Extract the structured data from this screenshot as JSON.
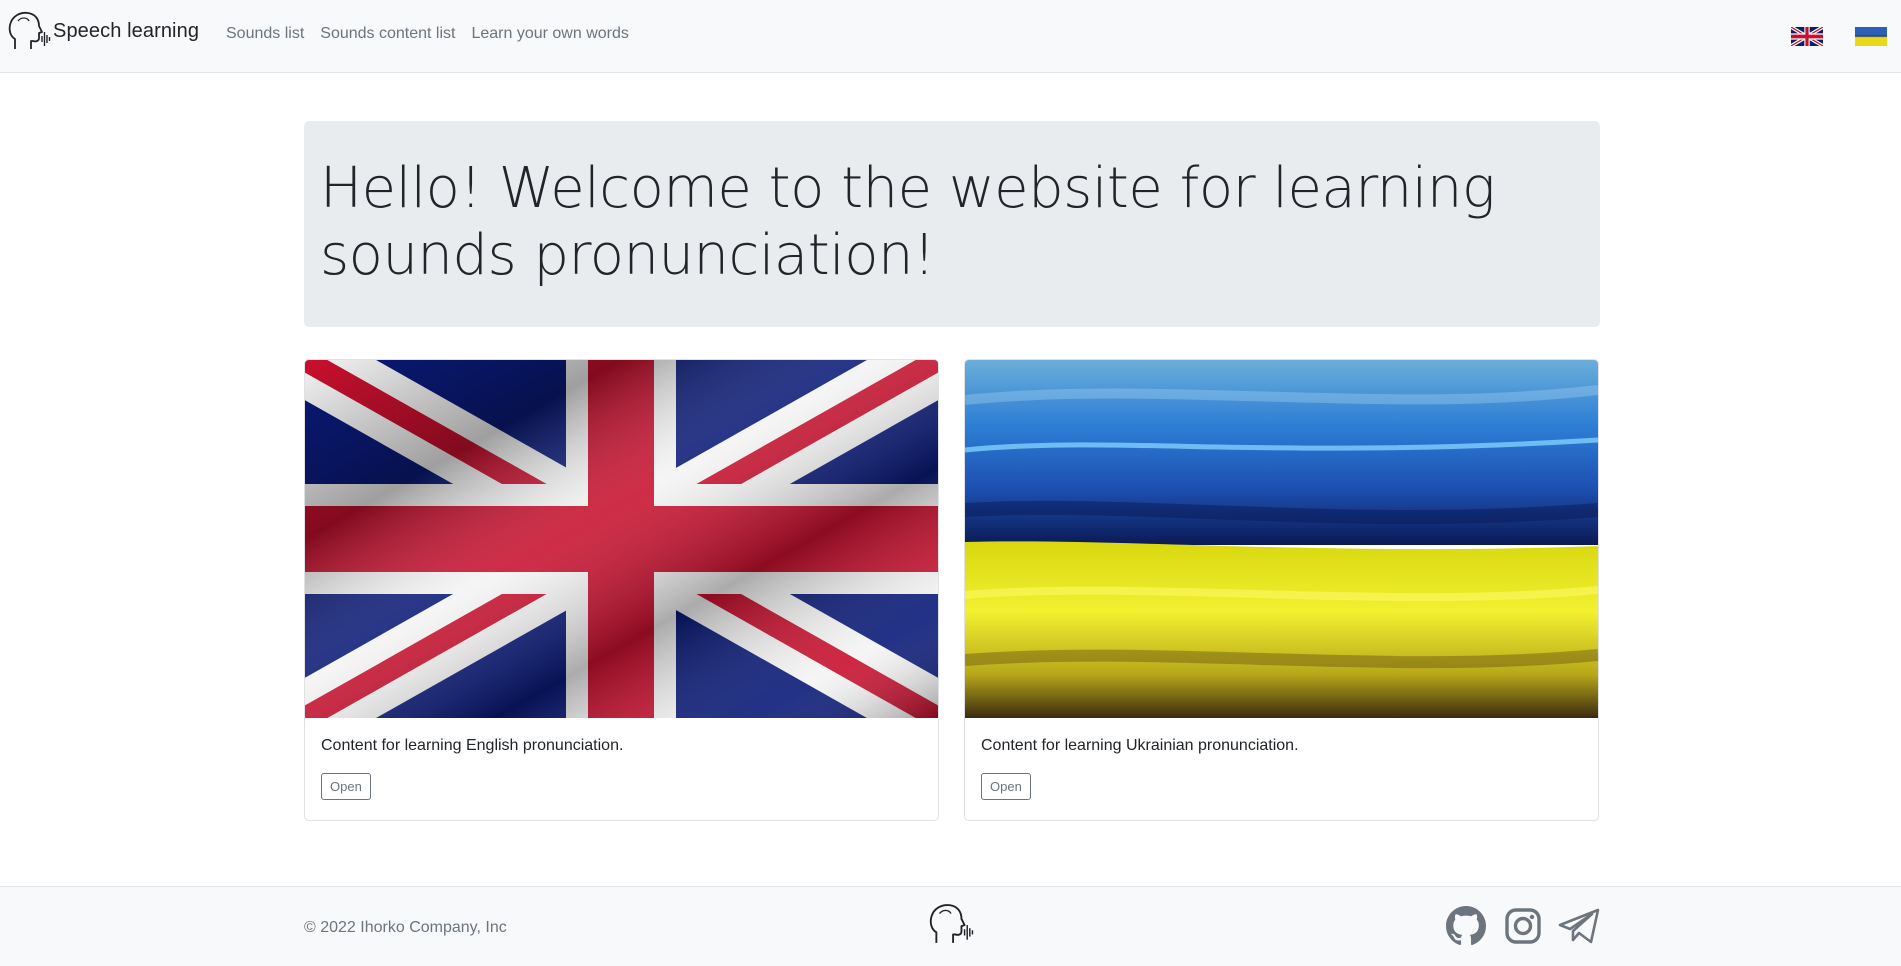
{
  "navbar": {
    "brand_name": "Speech learning",
    "links": [
      {
        "label": "Sounds list"
      },
      {
        "label": "Sounds content list"
      },
      {
        "label": "Learn your own words"
      }
    ],
    "languages": [
      "uk-flag-icon",
      "ukraine-flag-icon"
    ]
  },
  "hero": {
    "title": "Hello! Welcome to the website for learning sounds pronunciation!"
  },
  "cards": [
    {
      "image": "union-jack-flag-image",
      "text": "Content for learning English pronunciation.",
      "button_label": "Open"
    },
    {
      "image": "ukraine-flag-image",
      "text": "Content for learning Ukrainian pronunciation.",
      "button_label": "Open"
    }
  ],
  "footer": {
    "copyright": "© 2022 Ihorko Company, Inc",
    "social": [
      "github-icon",
      "instagram-icon",
      "telegram-icon"
    ]
  },
  "colors": {
    "navbar_bg": "#f8f9fa",
    "jumbotron_bg": "#e9ecef",
    "muted_text": "#6c757d",
    "uk_blue": "#012169",
    "uk_red": "#c8102e",
    "ua_blue": "#2e6fd4",
    "ua_yellow": "#f0e820"
  }
}
